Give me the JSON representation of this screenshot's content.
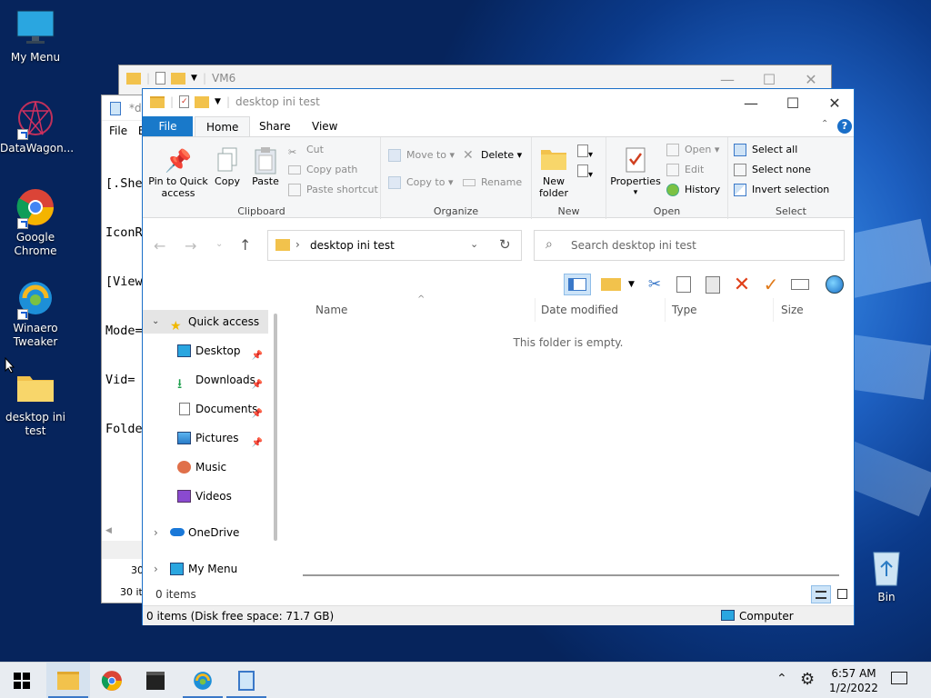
{
  "desktop": {
    "icons": [
      {
        "label": "My Menu"
      },
      {
        "label": "DataWagon..."
      },
      {
        "label": "Google Chrome"
      },
      {
        "label": "Winaero Tweaker"
      },
      {
        "label": "desktop ini test"
      },
      {
        "label": "Bin"
      }
    ]
  },
  "back_window": {
    "title": "VM6"
  },
  "notepad": {
    "title": "*de",
    "menu": [
      "File",
      "E"
    ],
    "lines": [
      "[.She",
      "IconR",
      "[View",
      "Mode=",
      "Vid=",
      "Folde"
    ],
    "status_a": "30",
    "status_b": "30 it"
  },
  "explorer": {
    "title": "desktop ini test",
    "tabs": {
      "file": "File",
      "home": "Home",
      "share": "Share",
      "view": "View"
    },
    "help": "?",
    "ribbon": {
      "clipboard": {
        "label": "Clipboard",
        "pin": "Pin to Quick access",
        "copy": "Copy",
        "paste": "Paste",
        "cut": "Cut",
        "copy_path": "Copy path",
        "paste_shortcut": "Paste shortcut"
      },
      "organize": {
        "label": "Organize",
        "move_to": "Move to",
        "copy_to": "Copy to",
        "delete": "Delete",
        "rename": "Rename"
      },
      "new": {
        "label": "New",
        "new_folder": "New folder"
      },
      "open": {
        "label": "Open",
        "properties": "Properties",
        "open": "Open",
        "edit": "Edit",
        "history": "History"
      },
      "select": {
        "label": "Select",
        "select_all": "Select all",
        "select_none": "Select none",
        "invert": "Invert selection"
      }
    },
    "address": {
      "path": "desktop ini test"
    },
    "search": {
      "placeholder": "Search desktop ini test"
    },
    "nav": {
      "quick_access": "Quick access",
      "items": [
        "Desktop",
        "Downloads",
        "Documents",
        "Pictures",
        "Music",
        "Videos"
      ],
      "onedrive": "OneDrive",
      "my_menu": "My Menu"
    },
    "columns": {
      "name": "Name",
      "date": "Date modified",
      "type": "Type",
      "size": "Size"
    },
    "empty_text": "This folder is empty.",
    "item_count": "0 items",
    "status": {
      "left": "0 items (Disk free space: 71.7 GB)",
      "right": "Computer"
    }
  },
  "taskbar": {
    "time": "6:57 AM",
    "date": "1/2/2022"
  },
  "colors": {
    "accent": "#1a6fc8",
    "file_tab": "#1979ca",
    "delete_red": "#e0401a",
    "check_orange": "#e07a1a"
  }
}
